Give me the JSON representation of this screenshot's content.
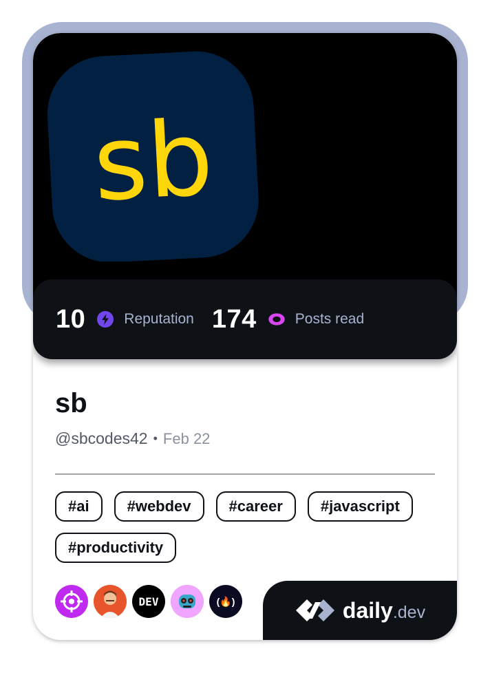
{
  "profile": {
    "avatar_text": "sb",
    "name": "sb",
    "handle": "@sbcodes42",
    "separator": "•",
    "joined": "Feb 22"
  },
  "stats": {
    "reputation_value": "10",
    "reputation_label": "Reputation",
    "posts_value": "174",
    "posts_label": "Posts read"
  },
  "tags": [
    "#ai",
    "#webdev",
    "#career",
    "#javascript",
    "#productivity"
  ],
  "sources": [
    {
      "icon": "crosshair-source-icon"
    },
    {
      "icon": "person-source-icon"
    },
    {
      "icon": "dev-source-icon",
      "text": "DEV"
    },
    {
      "icon": "robot-source-icon"
    },
    {
      "icon": "freecodecamp-source-icon",
      "text": "(🔥)"
    }
  ],
  "brand": {
    "name": "daily",
    "tld": ".dev"
  },
  "colors": {
    "frame": "#a8b3d1",
    "avatar_bg": "#022041",
    "avatar_text": "#ffd60a",
    "reputation_icon": "#7147ed",
    "posts_icon": "#d946ef",
    "dark": "#0e1217"
  }
}
